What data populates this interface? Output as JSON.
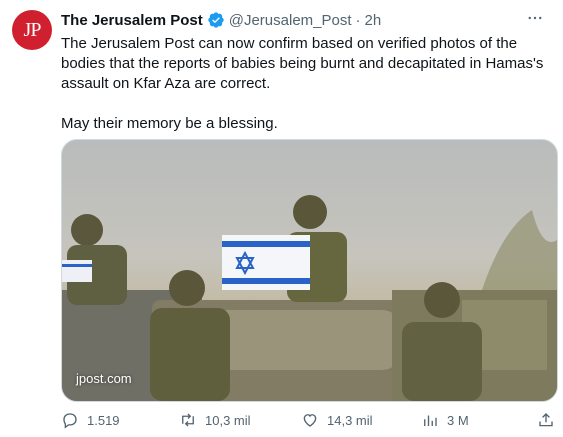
{
  "author": {
    "name": "The Jerusalem Post",
    "handle": "@Jerusalem_Post",
    "time": "2h",
    "avatar_text": "JP",
    "verified_color": "#1d9bf0"
  },
  "tweet": {
    "paragraphs": [
      "The Jerusalem Post can now confirm based on verified photos of the bodies that the reports of babies being burnt and decapitated in Hamas's assault on Kfar Aza are correct.",
      "May their memory be a blessing."
    ]
  },
  "media": {
    "watermark": "jpost.com"
  },
  "actions": {
    "replies": "1.519",
    "reposts": "10,3 mil",
    "likes": "14,3 mil",
    "views": "3 M"
  },
  "colors": {
    "brand_red": "#d0202f",
    "muted": "#536471",
    "text": "#0f1419"
  }
}
